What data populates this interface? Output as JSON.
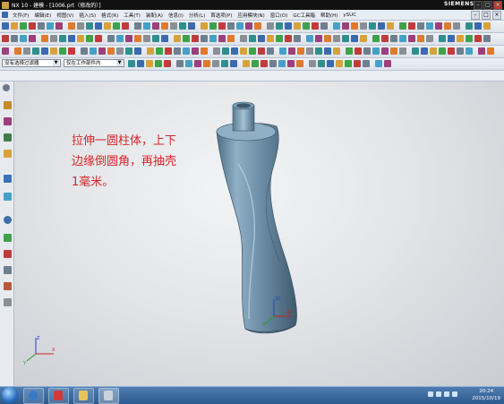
{
  "window": {
    "title": "NX 10 - 建模 - [1006.prt（修改的）]",
    "brand": "SIEMENS",
    "minimize": "–",
    "maximize": "□",
    "close": "×"
  },
  "menu": {
    "items": [
      "文件(F)",
      "编辑(E)",
      "视图(V)",
      "插入(S)",
      "格式(R)",
      "工具(T)",
      "装配(A)",
      "信息(I)",
      "分析(L)",
      "首选项(P)",
      "应用模块(N)",
      "窗口(O)",
      "GC工具箱",
      "帮助(H)",
      "ySUC"
    ]
  },
  "selection_bar": {
    "filter_value": "没有选择过滤器",
    "scope_value": "仅在工作部件内"
  },
  "viewport": {
    "note_lines": [
      "拉伸一圆柱体，上下",
      "边缘倒圆角，再抽壳",
      "1毫米。"
    ],
    "model_color": "#6e8fa5",
    "note_color": "#d8262a"
  },
  "taskbar": {
    "time": "20:24",
    "date": "2015/10/19"
  }
}
